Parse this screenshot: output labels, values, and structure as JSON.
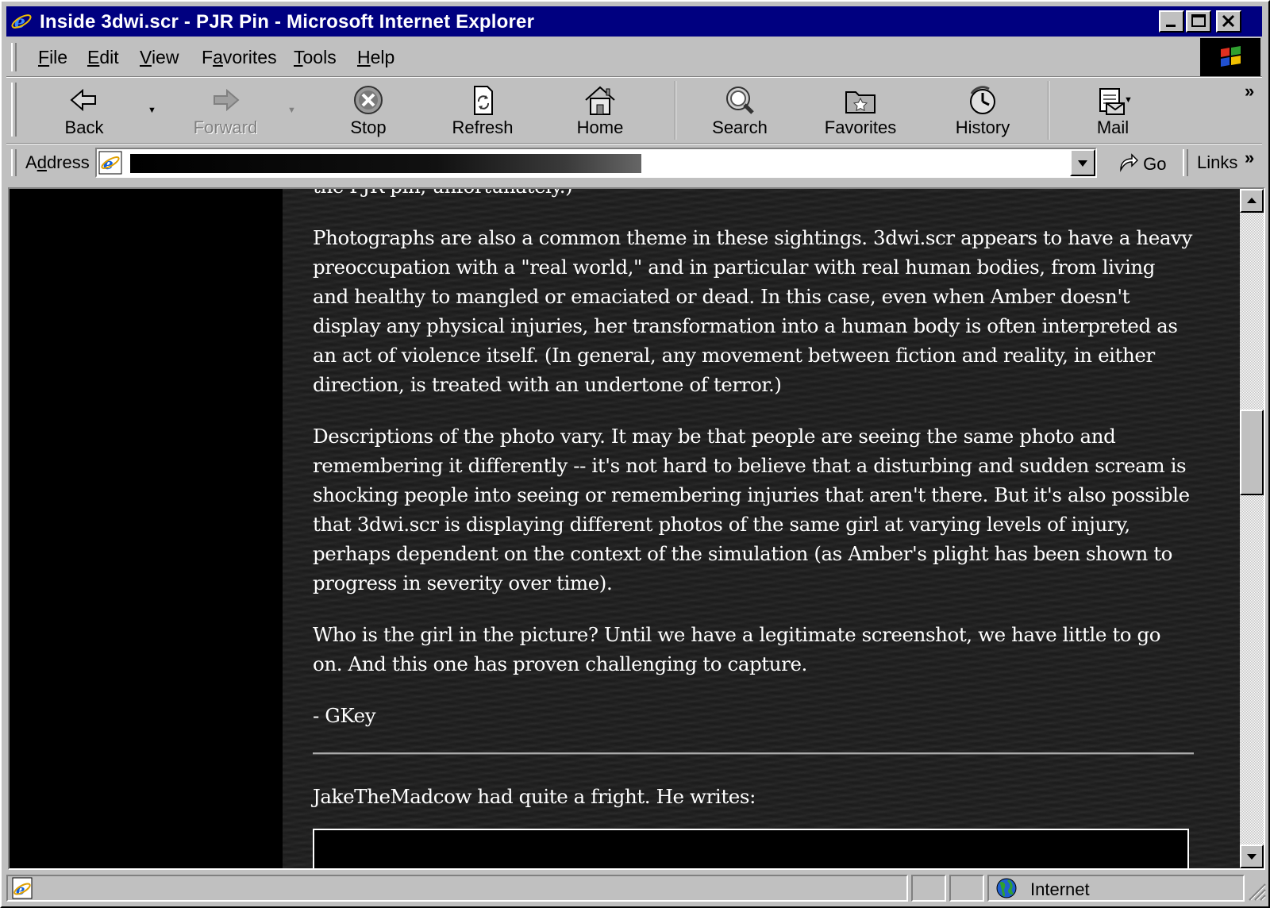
{
  "window": {
    "title": "Inside 3dwi.scr - PJR Pin - Microsoft Internet Explorer"
  },
  "menu": {
    "items": [
      {
        "label": "File",
        "key": "F",
        "rest": "ile"
      },
      {
        "label": "Edit",
        "key": "E",
        "rest": "dit"
      },
      {
        "label": "View",
        "key": "V",
        "rest": "iew"
      },
      {
        "label": "Favorites",
        "pre": "F",
        "key": "a",
        "rest": "vorites"
      },
      {
        "label": "Tools",
        "key": "T",
        "rest": "ools"
      },
      {
        "label": "Help",
        "key": "H",
        "rest": "elp"
      }
    ]
  },
  "toolbar": {
    "back": "Back",
    "forward": "Forward",
    "stop": "Stop",
    "refresh": "Refresh",
    "home": "Home",
    "search": "Search",
    "favorites": "Favorites",
    "history": "History",
    "mail": "Mail",
    "chevron": "»"
  },
  "address": {
    "label": "Address",
    "label_key": "d",
    "go": "Go",
    "links": "Links",
    "chevron": "»"
  },
  "article": {
    "partial_top": "the PJR pin, unfortunately.)",
    "p1": "Photographs are also a common theme in these sightings. 3dwi.scr appears to have a heavy preoccupation with a \"real world,\" and in particular with real human bodies, from living and healthy to mangled or emaciated or dead. In this case, even when Amber doesn't display any physical injuries, her transformation into a human body is often interpreted as an act of violence itself. (In general, any movement between fiction and reality, in either direction, is treated with an undertone of terror.)",
    "p2": "Descriptions of the photo vary. It may be that people are seeing the same photo and remembering it differently -- it's not hard to believe that a disturbing and sudden scream is shocking people into seeing or remembering injuries that aren't there. But it's also possible that 3dwi.scr is displaying different photos of the same girl at varying levels of injury, perhaps dependent on the context of the simulation (as Amber's plight has been shown to progress in severity over time).",
    "p3": "Who is the girl in the picture? Until we have a legitimate screenshot, we have little to go on. And this one has proven challenging to capture.",
    "signature": "- GKey",
    "p4": "JakeTheMadcow had quite a fright. He writes:"
  },
  "status": {
    "zone": "Internet"
  },
  "colors": {
    "titlebar": "#000080",
    "chrome": "#c0c0c0",
    "page_bg": "#1c1c1c",
    "text": "#ffffff"
  }
}
